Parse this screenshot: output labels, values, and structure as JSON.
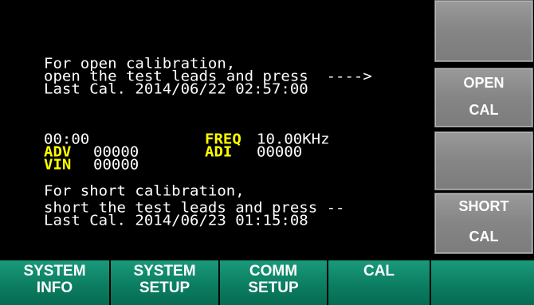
{
  "open": {
    "line1": "For open calibration,",
    "line2": "open the test leads and press  ---->",
    "line3": "Last Cal. 2014/06/22 02:57:00"
  },
  "status": {
    "time": "00:00",
    "freq_label": "FREQ",
    "freq_value": "10.00KHz",
    "adv_label": "ADV",
    "adv_value": "00000",
    "adi_label": "ADI",
    "adi_value": "00000",
    "vin_label": "VIN",
    "vin_value": "00000"
  },
  "short": {
    "line1": "For short calibration,",
    "line2": "short the test leads and press --",
    "line3": "Last Cal. 2014/06/23 01:15:08"
  },
  "side_buttons": {
    "open_line1": "OPEN",
    "open_line2": "CAL",
    "short_line1": "SHORT",
    "short_line2": "CAL"
  },
  "bottom_buttons": {
    "system_info_1": "SYSTEM",
    "system_info_2": "INFO",
    "system_setup_1": "SYSTEM",
    "system_setup_2": "SETUP",
    "comm_setup_1": "COMM",
    "comm_setup_2": "SETUP",
    "cal": "CAL"
  },
  "colors": {
    "highlight": "#ffff00",
    "softkey": "#0c7e62",
    "side_button": "#8c8c8c"
  }
}
